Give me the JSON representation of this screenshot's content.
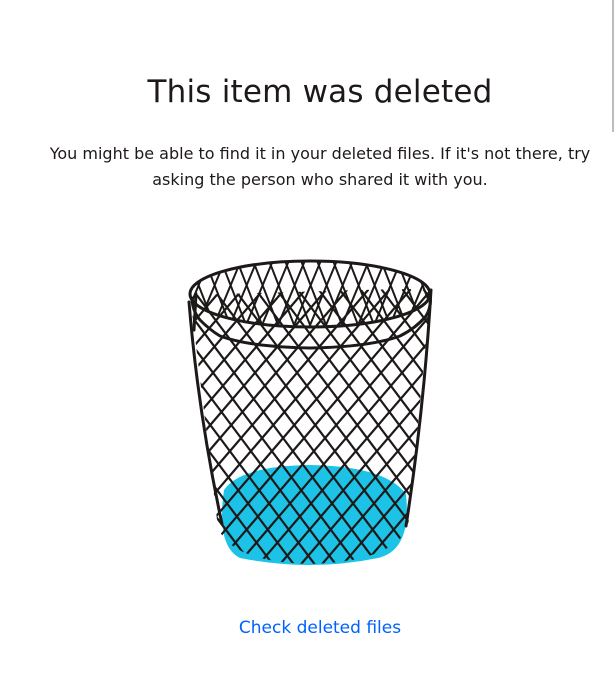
{
  "page": {
    "title": "This item was deleted",
    "description": "You might be able to find it in your deleted files. If it's not there, try asking the person who shared it with you.",
    "link_label": "Check deleted files"
  },
  "illustration": {
    "icon": "trash-basket-icon",
    "fill_color": "#1cc3e7",
    "stroke_color": "#1e1919"
  },
  "colors": {
    "link": "#0061fe",
    "text": "#1e1919",
    "background": "#ffffff"
  }
}
